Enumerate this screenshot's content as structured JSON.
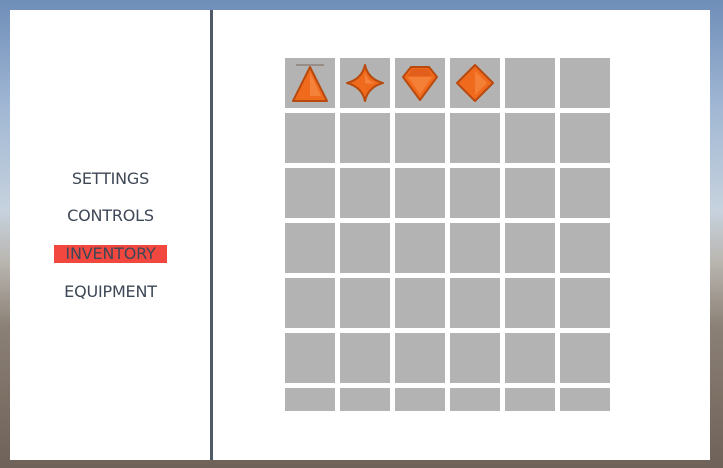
{
  "menu": {
    "items": [
      {
        "id": "settings",
        "label": "SETTINGS",
        "active": false
      },
      {
        "id": "controls",
        "label": "CONTROLS",
        "active": false
      },
      {
        "id": "inventory",
        "label": "INVENTORY",
        "active": true
      },
      {
        "id": "equipment",
        "label": "EQUIPMENT",
        "active": false
      }
    ],
    "active_color": "#f2473f",
    "text_color": "#3d4756"
  },
  "inventory": {
    "columns": 6,
    "visible_rows": 7,
    "slot_color": "#b3b3b3",
    "item_color": "#f06a1e",
    "items": [
      {
        "slot": 0,
        "icon": "triangle-gem-icon"
      },
      {
        "slot": 1,
        "icon": "star-gem-icon"
      },
      {
        "slot": 2,
        "icon": "pentagon-gem-icon"
      },
      {
        "slot": 3,
        "icon": "diamond-gem-icon"
      }
    ]
  }
}
